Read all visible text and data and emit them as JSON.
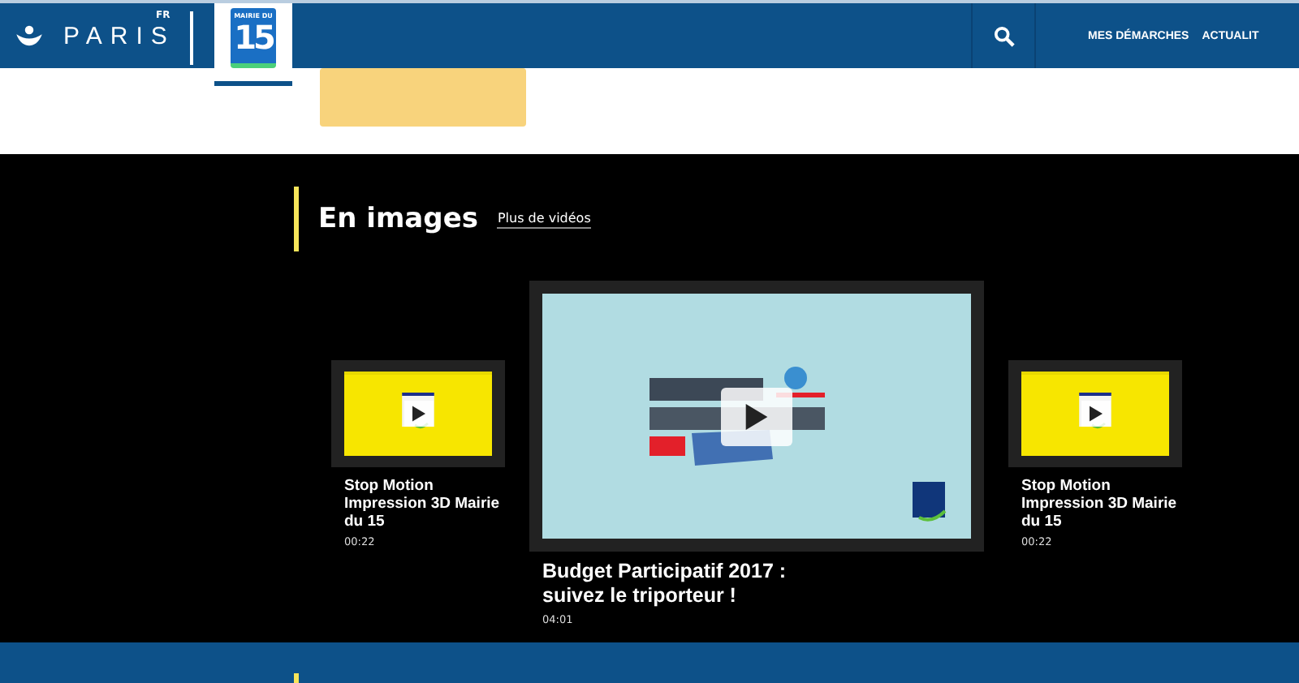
{
  "header": {
    "brand": "PARIS",
    "lang": "FR",
    "mairie_logo": {
      "label": "MAIRIE DU",
      "number": "15"
    },
    "nav": [
      "MES DÉMARCHES",
      "ACTUALIT"
    ]
  },
  "section": {
    "title": "En images",
    "link": "Plus de vidéos",
    "videos": [
      {
        "title": "Stop Motion Impression 3D Mairie du 15",
        "duration": "00:22",
        "featured": false,
        "kind": "picture"
      },
      {
        "title": "Budget Participatif 2017 : suivez le triporteur !",
        "duration": "04:01",
        "featured": true,
        "kind": "picture"
      },
      {
        "title": "Stop Motion Impression 3D Mairie du 15",
        "duration": "00:22",
        "featured": false,
        "kind": "picture"
      }
    ]
  }
}
